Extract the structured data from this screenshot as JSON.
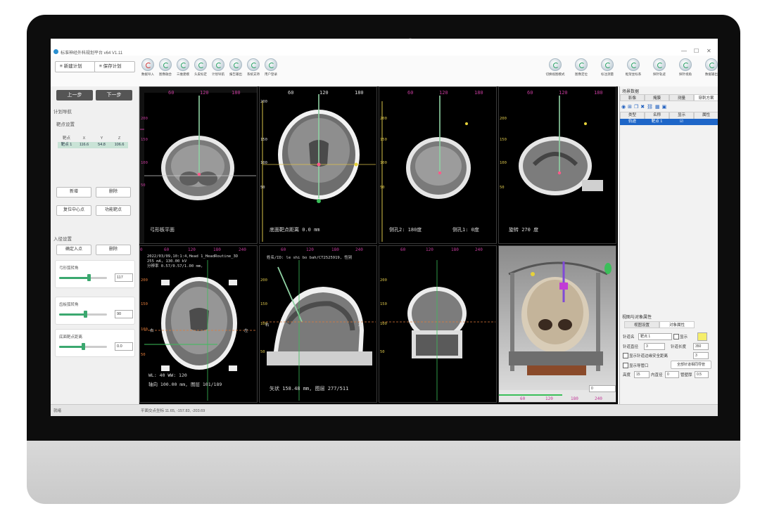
{
  "app": {
    "title": "标准神经外科规划平台 v64 V1.11",
    "min": "—",
    "max": "☐",
    "close": "✕"
  },
  "toolbar": {
    "new_plan": "新建计划",
    "save_plan": "保存计划",
    "left_tools": [
      {
        "label": "数据导入",
        "icon": "import-icon"
      },
      {
        "label": "图像融合",
        "icon": "fusion-icon"
      },
      {
        "label": "三维建模",
        "icon": "3d-model-icon"
      },
      {
        "label": "头皮标定",
        "icon": "calibrate-icon"
      },
      {
        "label": "计划导航",
        "icon": "navigate-icon"
      },
      {
        "label": "报告输出",
        "icon": "report-icon"
      },
      {
        "label": "系统支持",
        "icon": "support-icon"
      },
      {
        "label": "用户登录",
        "icon": "user-icon"
      }
    ],
    "right_tools": [
      {
        "label": "切换视图模式",
        "icon": "view-mode-icon"
      },
      {
        "label": "图像定位",
        "icon": "locate-icon"
      },
      {
        "label": "标注测量",
        "icon": "measure-icon"
      },
      {
        "label": "框架坐标系",
        "icon": "frame-icon"
      },
      {
        "label": "探针轨迹",
        "icon": "probe-icon"
      },
      {
        "label": "探针视角",
        "icon": "probe-view-icon"
      },
      {
        "label": "数据输出",
        "icon": "export-icon"
      }
    ]
  },
  "left": {
    "prev": "上一步",
    "next": "下一步",
    "plan_nav": "计划导航",
    "target_settings": "靶点设置",
    "table_headers": [
      "靶点",
      "X",
      "Y",
      "Z"
    ],
    "table_row": [
      "靶点 1",
      "116.6",
      "54.8",
      "106.6"
    ],
    "add": "新增",
    "delete": "删除",
    "reset_center": "复位中心点",
    "func_target": "功能靶点",
    "entry_settings": "入径设置",
    "confirm_entry": "确定入点",
    "entry_delete": "删除",
    "sliders": [
      {
        "label": "弓形弧转角",
        "value": "117",
        "pct": 0.62
      },
      {
        "label": "齿板弧转角",
        "value": "90",
        "pct": 0.55
      },
      {
        "label": "底面靶点距离",
        "value": "0.0",
        "pct": 0.5
      }
    ]
  },
  "views": {
    "v1": {
      "label": "弓形板平面",
      "ticks": [
        "60",
        "120",
        "180"
      ],
      "vticks": [
        "200",
        "150",
        "100",
        "50"
      ]
    },
    "v2": {
      "label": "底面靶点距离  0.0  mm",
      "ticks": [
        "60",
        "120",
        "180"
      ],
      "vticks": [
        "200",
        "150",
        "100",
        "50"
      ]
    },
    "v3": {
      "label": "侧孔2: 180度",
      "label2": "侧孔1: 0度",
      "ticks": [
        "60",
        "120",
        "180"
      ],
      "vticks": [
        "200",
        "150",
        "100",
        "50"
      ]
    },
    "v4": {
      "label": "旋转  270  度",
      "ticks": [
        "60",
        "120",
        "180"
      ],
      "vticks": [
        "200",
        "150",
        "100",
        "50"
      ]
    },
    "v5": {
      "info": "2022/03/09,10:1:4,Head 1_HeadRoutine_3D\n255 mA, 130.00 kV\n分辨率 0.57/0.57/1.00 mm,",
      "wl": "WL:  40   WW:  120",
      "axial": "轴向 100.00  mm, 图层 101/189",
      "ticks": [
        "0",
        "60",
        "120",
        "180",
        "240"
      ],
      "vticks": [
        "200",
        "150",
        "100",
        "50"
      ],
      "left_mark": "右",
      "right_mark": "左"
    },
    "v6": {
      "info": "姓名/ID: le shi bo bah/CT2525919, 性别",
      "sag": "矢状 158.48 mm, 图层 277/511",
      "ticks": [
        "60",
        "120",
        "180",
        "240"
      ],
      "vticks": [
        "200",
        "150",
        "100",
        "50"
      ],
      "left_mark": "右",
      "right_mark": "左"
    },
    "v7": {
      "ticks": [
        "60",
        "120",
        "180",
        "240"
      ],
      "vticks": [
        "200",
        "150",
        "100",
        "50"
      ]
    },
    "v8": {
      "value": "0",
      "ticks": [
        "0",
        "60",
        "120",
        "180",
        "240"
      ]
    }
  },
  "right": {
    "scene_title": "场景数据",
    "tabs": [
      "影像",
      "掩膜",
      "测量",
      "穿刺方案"
    ],
    "grid_headers": [
      "类型",
      "名称",
      "显示",
      "属性"
    ],
    "grid_row": [
      "轨迹",
      "靶点 1",
      "",
      ""
    ],
    "prop_title": "视图与对象属性",
    "prop_tabs": [
      "视图设置",
      "对象属性"
    ],
    "needle_name_label": "针道名",
    "needle_name": "靶点 1",
    "show": "显示",
    "needle_diam_label": "针道直径",
    "needle_diam": "3",
    "needle_len_label": "针道长度",
    "needle_len": "350",
    "show_safety": "显示针道边缘安全距离",
    "safety_val": "3",
    "show_guide": "显示导管口",
    "all_guide": "全部针道相同导管",
    "height_label": "高度",
    "height": "15",
    "inner_label": "内直径",
    "inner": "0",
    "wall_label": "管壁厚",
    "wall": "0.5"
  },
  "status": {
    "ready": "就绪",
    "coords": "平面交点坐标 11.65, -157.83, -203.69"
  }
}
